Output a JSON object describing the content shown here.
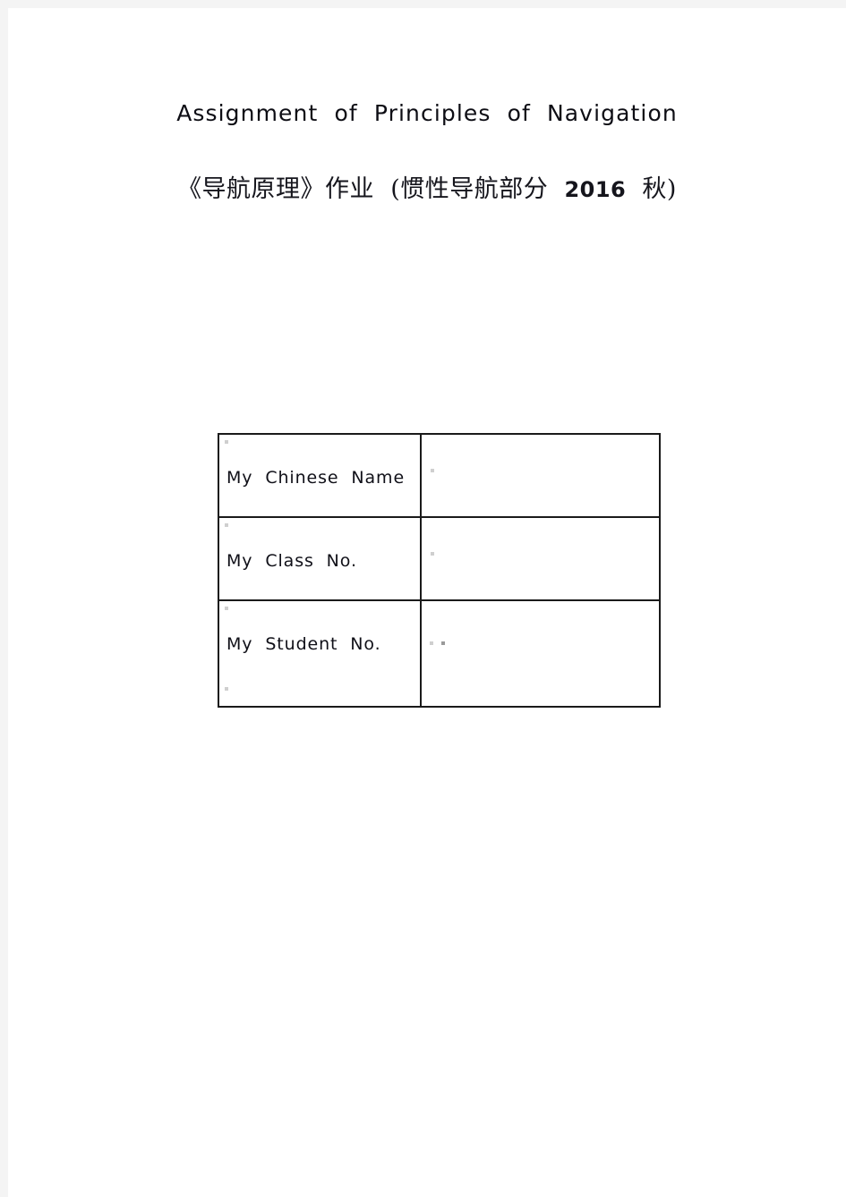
{
  "page": {
    "background_color": "#ffffff",
    "margin_color": "#f4f4f4",
    "ink_color": "#101018",
    "rule_color": "#1a1a1a"
  },
  "document": {
    "title": "Assignment  of  Principles  of  Navigation",
    "subtitle_prefix": "《导航原理》作业  (惯性导航部分  ",
    "subtitle_year": "2016",
    "subtitle_suffix": "  秋)"
  },
  "info_table": {
    "rows": [
      {
        "label": "My  Chinese  Name",
        "value": ""
      },
      {
        "label": "My  Class  No.",
        "value": ""
      },
      {
        "label": "My  Student  No.",
        "value": ""
      }
    ]
  }
}
